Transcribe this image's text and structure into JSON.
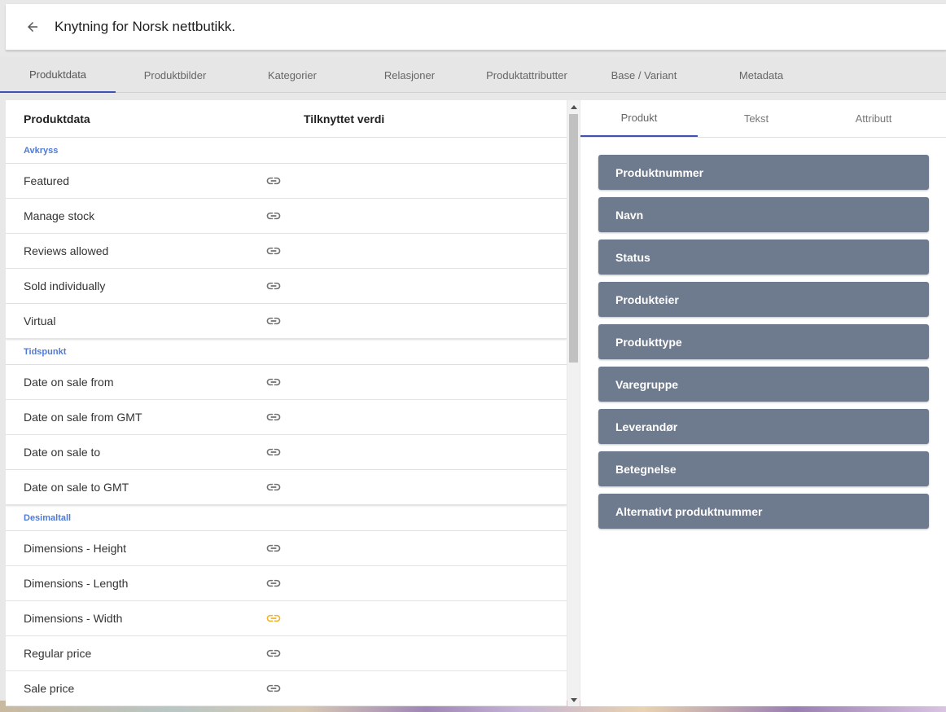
{
  "header": {
    "title": "Knytning for Norsk nettbutikk."
  },
  "tabs": [
    {
      "label": "Produktdata",
      "active": true
    },
    {
      "label": "Produktbilder",
      "active": false
    },
    {
      "label": "Kategorier",
      "active": false
    },
    {
      "label": "Relasjoner",
      "active": false
    },
    {
      "label": "Produktattributter",
      "active": false
    },
    {
      "label": "Base / Variant",
      "active": false
    },
    {
      "label": "Metadata",
      "active": false
    }
  ],
  "table": {
    "headers": [
      "Produktdata",
      "Tilknyttet verdi"
    ],
    "groups": [
      {
        "title": "Avkryss",
        "rows": [
          "Featured",
          "Manage stock",
          "Reviews allowed",
          "Sold individually",
          "Virtual"
        ]
      },
      {
        "title": "Tidspunkt",
        "rows": [
          "Date on sale from",
          "Date on sale from GMT",
          "Date on sale to",
          "Date on sale to GMT"
        ]
      },
      {
        "title": "Desimaltall",
        "rows": [
          "Dimensions - Height",
          "Dimensions - Length",
          "Dimensions - Width",
          "Regular price",
          "Sale price"
        ]
      }
    ],
    "highlighted_row": "Dimensions - Width"
  },
  "right_tabs": [
    {
      "label": "Produkt",
      "active": true
    },
    {
      "label": "Tekst",
      "active": false
    },
    {
      "label": "Attributt",
      "active": false
    }
  ],
  "chips": [
    "Produktnummer",
    "Navn",
    "Status",
    "Produkteier",
    "Produkttype",
    "Varegruppe",
    "Leverandør",
    "Betegnelse",
    "Alternativt produktnummer"
  ],
  "colors": {
    "accent": "#3f51b5",
    "group_title": "#4f7ad8",
    "chip_bg": "#6e7a8e",
    "link_icon": "#707070",
    "link_icon_highlight": "#f0b429"
  }
}
